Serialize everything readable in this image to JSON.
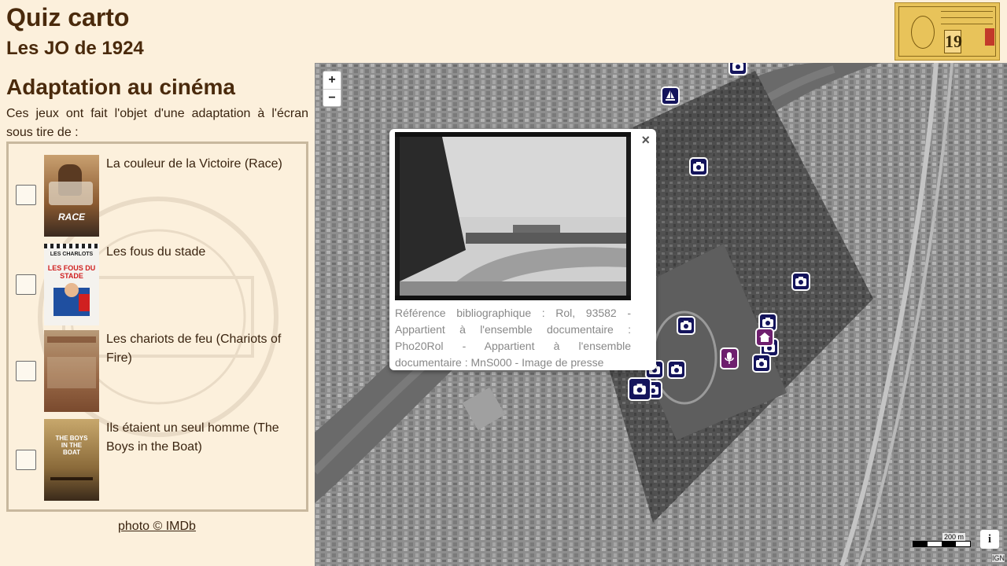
{
  "header": {
    "title": "Quiz carto",
    "subtitle": "Les JO de 1924",
    "ticket_number": "19"
  },
  "sidebar": {
    "section_title": "Adaptation au cinéma",
    "intro": "Ces jeux ont fait l'objet d'une adaptation à l'écran sous tire de :",
    "films": [
      {
        "title": "La couleur de la Victoire (Race)",
        "poster_text": "RACE",
        "checked": false
      },
      {
        "title": "Les fous du stade",
        "poster_text": "LES FOUS DU STADE",
        "poster_top": "LES CHARLOTS",
        "checked": false
      },
      {
        "title": "Les chariots de feu (Chariots of Fire)",
        "checked": false
      },
      {
        "title": "Ils étaient un seul homme (The Boys in the Boat)",
        "poster_text": "THE BOYS IN THE BOAT",
        "checked": false
      }
    ],
    "credit": "photo © IMDb"
  },
  "map": {
    "zoom_in": "+",
    "zoom_out": "−",
    "popup": {
      "close": "×",
      "text": "Référence bibliographique : Rol, 93582 - Appartient à l'ensemble documentaire : Pho20Rol - Appartient à l'ensemble documentaire : MnS000 - Image de presse"
    },
    "scale_label": "200 m",
    "info_label": "i",
    "attribution": "IGN"
  },
  "colors": {
    "background": "#fcf0dc",
    "heading": "#4a2a0c",
    "marker_photo": "#14145c",
    "marker_purple": "#6e1f6e"
  }
}
